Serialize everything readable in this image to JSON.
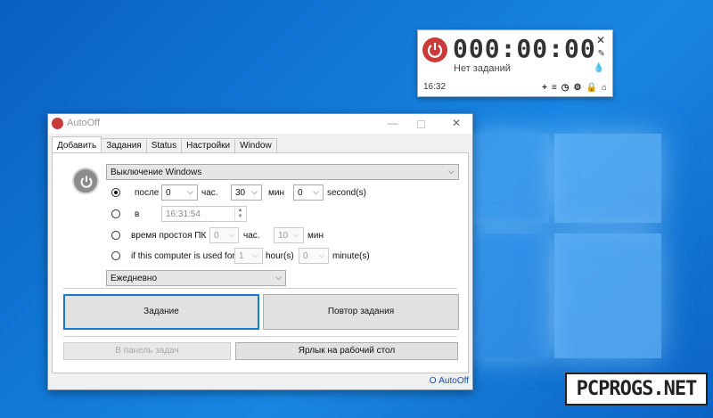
{
  "desktop": {
    "logo": "windows-logo"
  },
  "timer_widget": {
    "time": "000:00:00",
    "status": "Нет заданий",
    "clock": "16:32",
    "close_icon": "✕",
    "pin_icon": "✎",
    "drop_icon": "💧",
    "toolbar_icons": [
      "plus-icon",
      "list-icon",
      "clock-icon",
      "gear-icon",
      "lock-icon",
      "home-icon"
    ],
    "toolbar_glyphs": [
      "+",
      "≡",
      "◷",
      "⚙",
      "🔒",
      "⌂"
    ]
  },
  "window": {
    "title": "AutoOff",
    "minimize": "—",
    "close": "✕",
    "tabs": [
      "Добавить",
      "Задания",
      "Status",
      "Настройки",
      "Window"
    ],
    "action_select": "Выключение Windows",
    "options": {
      "after": {
        "label": "после",
        "hours": "0",
        "hours_unit": "час.",
        "minutes": "30",
        "minutes_unit": "мин",
        "seconds": "0",
        "seconds_unit": "second(s)"
      },
      "at": {
        "label": "в",
        "time": "16:31:54"
      },
      "idle": {
        "label": "время простоя ПК",
        "hours": "0",
        "hours_unit": "час.",
        "minutes": "10",
        "minutes_unit": "мин"
      },
      "used": {
        "label": "if this computer is used for",
        "hours": "1",
        "hours_unit": "hour(s)",
        "minutes": "0",
        "minutes_unit": "minute(s)"
      }
    },
    "repeat_select": "Ежедневно",
    "buttons": {
      "task": "Задание",
      "repeat": "Повтор задания",
      "tray": "В панель задач",
      "shortcut": "Ярлык на рабочий стол"
    },
    "about": "О AutoOff"
  },
  "watermark": "PCPROGS.NET"
}
